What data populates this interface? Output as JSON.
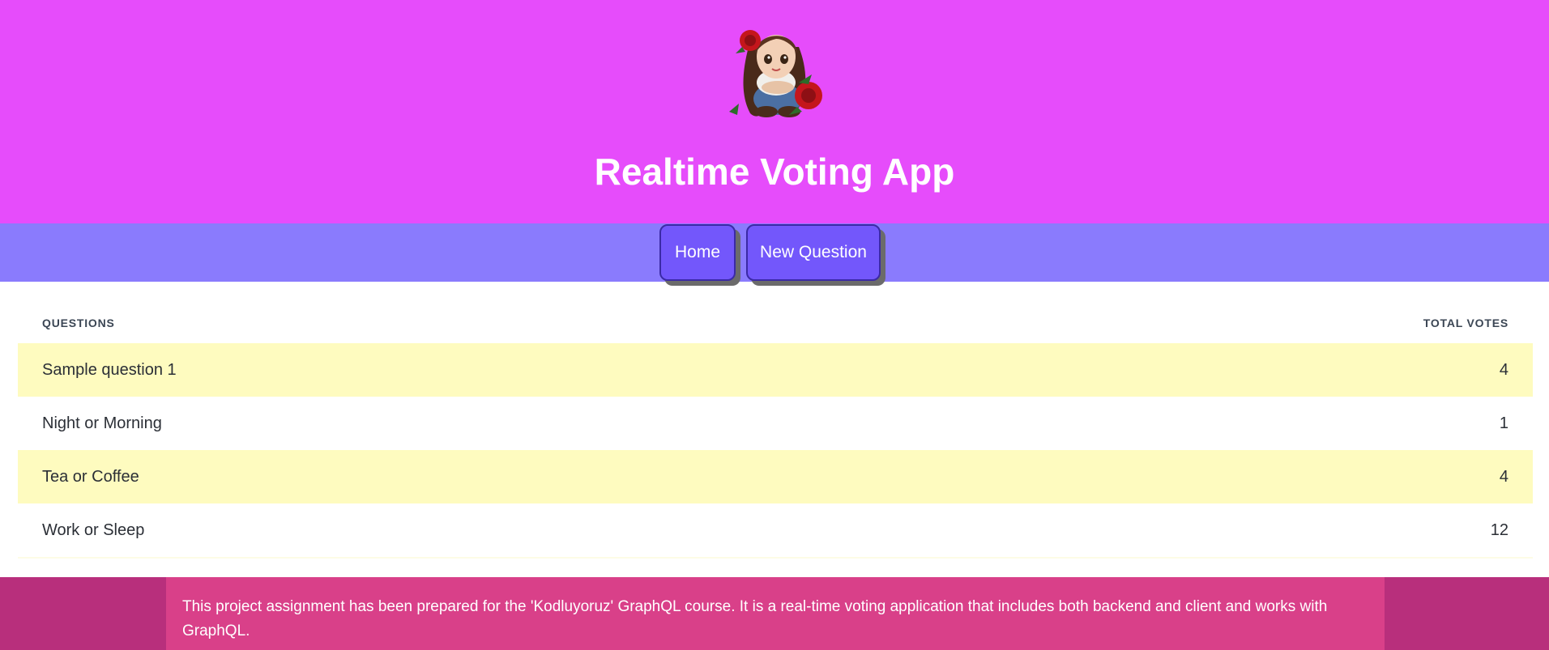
{
  "header": {
    "title": "Realtime Voting App",
    "background_color": "#e64cfb",
    "avatar_icon": "cartoon-girl-with-roses-avatar"
  },
  "nav": {
    "background_color": "#8a7bfd",
    "items": [
      {
        "label": "Home"
      },
      {
        "label": "New Question"
      }
    ]
  },
  "table": {
    "columns": [
      "QUESTIONS",
      "TOTAL VOTES"
    ],
    "rows": [
      {
        "question": "Sample question 1",
        "votes": "4"
      },
      {
        "question": "Night or Morning",
        "votes": "1"
      },
      {
        "question": "Tea or Coffee",
        "votes": "4"
      },
      {
        "question": "Work or Sleep",
        "votes": "12"
      }
    ],
    "odd_row_color": "#fefbbf"
  },
  "footer": {
    "text": "This project assignment has been prepared for the 'Kodluyoruz' GraphQL course. It is a real-time voting application that includes both backend and client and works with GraphQL.",
    "outer_color": "#b82f7c",
    "inner_color": "#d94089"
  }
}
